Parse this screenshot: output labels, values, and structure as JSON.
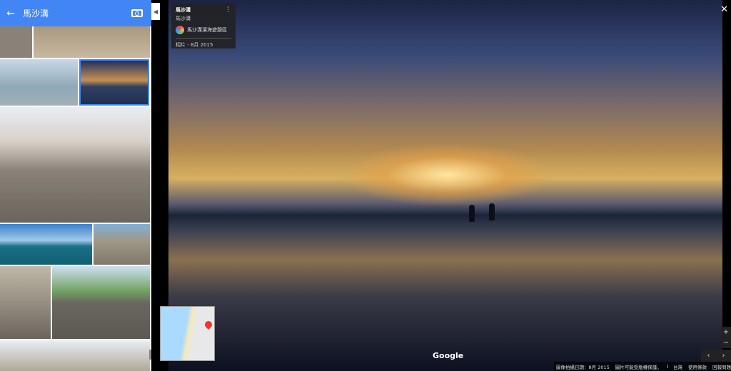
{
  "sidebar": {
    "title": "馬沙溝",
    "back_icon": "arrow-left-icon",
    "camera_icon": "add-photo-icon"
  },
  "card": {
    "title": "馬沙溝",
    "subtitle": "馬沙溝",
    "author": "馬沙溝濱海遊憩區",
    "date": "相片 - 8月 2015"
  },
  "viewer": {
    "close": "✕",
    "logo": "Google",
    "zoom_in": "+",
    "zoom_out": "−",
    "prev": "‹",
    "next": "›"
  },
  "footer": {
    "capture_date": "圖像拍攝日期：8月 2015",
    "copyright": "圖片可能受版權保護。",
    "region": "台灣",
    "terms": "使用條款",
    "report": "回報問題"
  }
}
